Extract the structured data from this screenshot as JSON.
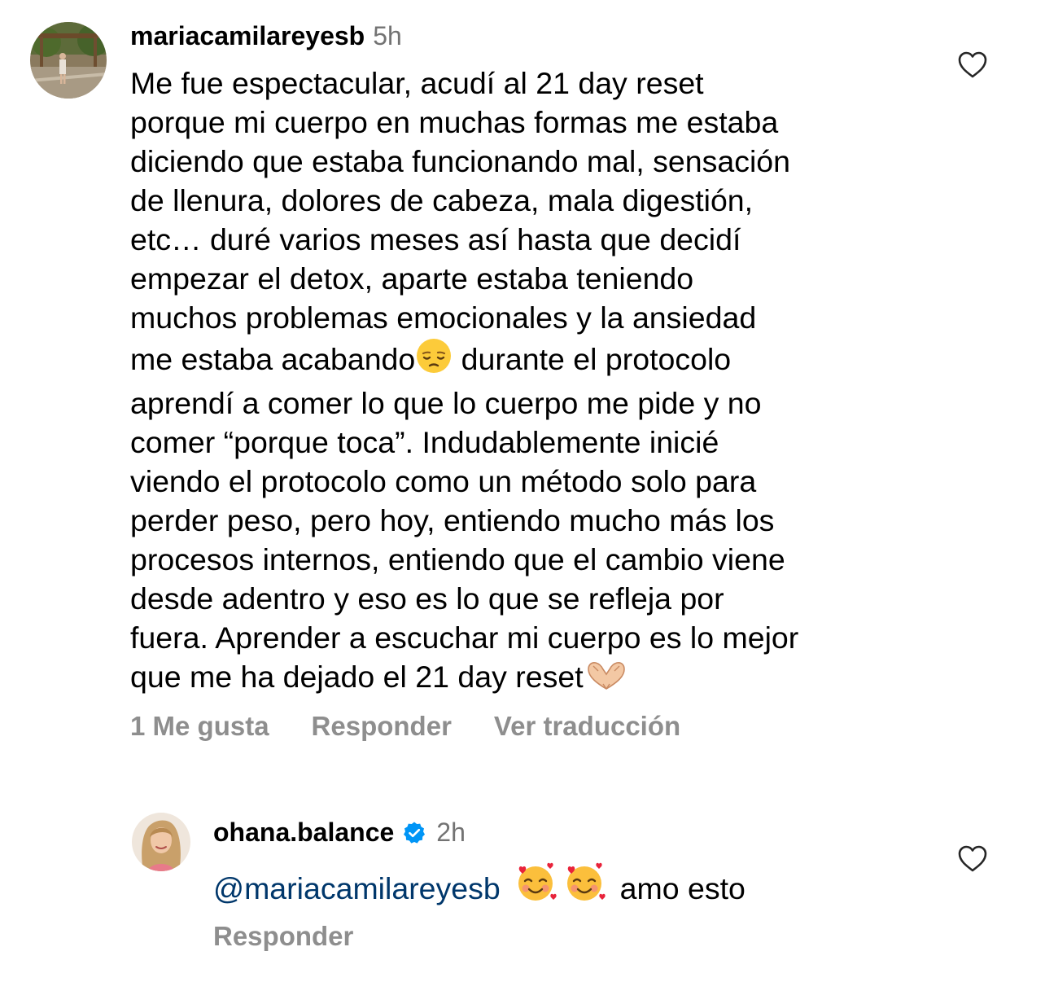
{
  "comment": {
    "username": "mariacamilareyesb",
    "time": "5h",
    "text_lines": [
      "Me fue espectacular, acudí al 21 day reset",
      "porque mi cuerpo en muchas formas me estaba",
      "diciendo que estaba funcionando mal, sensación",
      "de llenura, dolores de cabeza, mala digestión,",
      "etc… duré varios meses así hasta que decidí",
      "empezar el detox, aparte estaba teniendo",
      "muchos problemas emocionales y la ansiedad",
      "me estaba acabando",
      " durante el protocolo",
      "aprendí a comer lo que lo cuerpo me pide y no",
      "comer “porque toca”. Indudablemente inicié",
      "viendo el protocolo como un método solo para",
      "perder peso, pero hoy, entiendo mucho más los",
      "procesos internos, entiendo que el cambio viene",
      "desde adentro y eso es lo que se refleja por",
      "fuera. Aprender a escuchar mi cuerpo es lo mejor",
      "que me ha dejado el 21 day reset"
    ],
    "emojis": [
      "pensive-face-emoji",
      "heart-hands-emoji"
    ],
    "likes_label": "1 Me gusta",
    "reply_label": "Responder",
    "translate_label": "Ver traducción",
    "heart_icon": "heart-outline-icon"
  },
  "reply": {
    "username": "ohana.balance",
    "verified": true,
    "time": "2h",
    "mention": "@mariacamilareyesb",
    "emojis": [
      "smiling-face-with-hearts-emoji",
      "smiling-face-with-hearts-emoji"
    ],
    "text": "amo esto",
    "reply_label": "Responder",
    "heart_icon": "heart-outline-icon"
  },
  "colors": {
    "text": "#000000",
    "secondary": "#737373",
    "action": "#8e8e8e",
    "mention": "#00376b",
    "verified": "#0095f6"
  }
}
